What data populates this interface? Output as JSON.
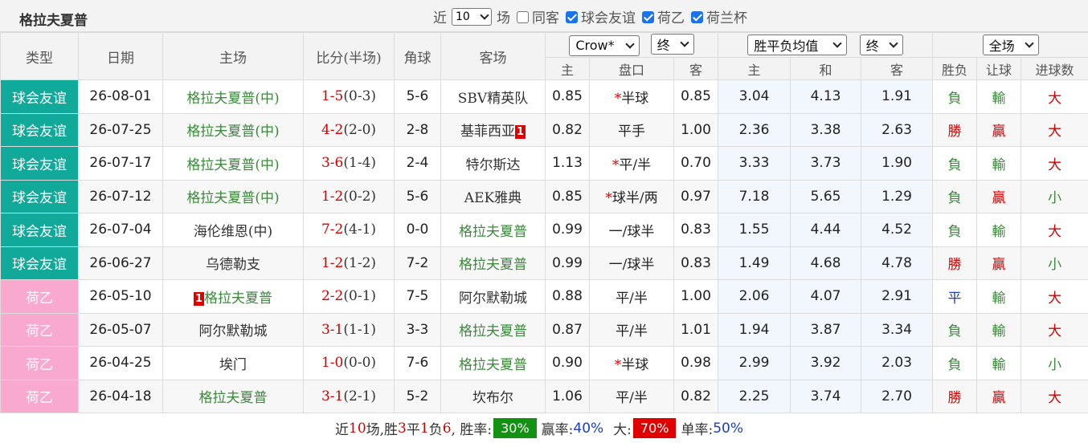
{
  "header": {
    "title": "格拉夫夏普",
    "recent_label": "近",
    "recent_value": "10",
    "unit_label": "场",
    "filters": [
      {
        "label": "同客",
        "checked": false
      },
      {
        "label": "球会友谊",
        "checked": true
      },
      {
        "label": "荷乙",
        "checked": true
      },
      {
        "label": "荷兰杯",
        "checked": true
      }
    ]
  },
  "columns": {
    "type": "类型",
    "date": "日期",
    "home": "主场",
    "score": "比分(半场)",
    "corners": "角球",
    "away": "客场",
    "handicap_company": "Crow*",
    "handicap_stage": "终",
    "euro_type": "胜平负均值",
    "euro_stage": "终",
    "scope": "全场",
    "sub_home": "主",
    "sub_line": "盘口",
    "sub_away": "客",
    "sub_euro_home": "主",
    "sub_euro_draw": "和",
    "sub_euro_away": "客",
    "sub_result": "胜负",
    "sub_handicap_result": "让球",
    "sub_goals": "进球数"
  },
  "matches": [
    {
      "type": "球会友谊",
      "kind": "friendly",
      "date": "26-08-01",
      "home": "格拉夫夏普(中)",
      "home_rank": "",
      "home_focus": true,
      "score": "1-5",
      "half": "(0-3)",
      "corners": "5-6",
      "away": "SBV精英队",
      "away_rank": "",
      "away_focus": false,
      "hcp_home": "0.85",
      "star": "*",
      "line": "半球",
      "hcp_away": "0.85",
      "eu_home": "3.04",
      "eu_draw": "4.13",
      "eu_away": "1.91",
      "result": "負",
      "hcp_result": "輸",
      "goals": "大"
    },
    {
      "type": "球会友谊",
      "kind": "friendly",
      "date": "26-07-25",
      "home": "格拉夫夏普(中)",
      "home_rank": "",
      "home_focus": true,
      "score": "4-2",
      "half": "(2-0)",
      "corners": "2-8",
      "away": "基菲西亚",
      "away_rank": "1",
      "away_focus": false,
      "hcp_home": "0.82",
      "star": "",
      "line": "平手",
      "hcp_away": "1.00",
      "eu_home": "2.36",
      "eu_draw": "3.38",
      "eu_away": "2.63",
      "result": "勝",
      "hcp_result": "贏",
      "goals": "大"
    },
    {
      "type": "球会友谊",
      "kind": "friendly",
      "date": "26-07-17",
      "home": "格拉夫夏普(中)",
      "home_rank": "",
      "home_focus": true,
      "score": "3-6",
      "half": "(1-4)",
      "corners": "2-4",
      "away": "特尔斯达",
      "away_rank": "",
      "away_focus": false,
      "hcp_home": "1.13",
      "star": "*",
      "line": "平/半",
      "hcp_away": "0.70",
      "eu_home": "3.33",
      "eu_draw": "3.73",
      "eu_away": "1.90",
      "result": "負",
      "hcp_result": "輸",
      "goals": "大"
    },
    {
      "type": "球会友谊",
      "kind": "friendly",
      "date": "26-07-12",
      "home": "格拉夫夏普(中)",
      "home_rank": "",
      "home_focus": true,
      "score": "1-2",
      "half": "(0-2)",
      "corners": "5-6",
      "away": "AEK雅典",
      "away_rank": "",
      "away_focus": false,
      "hcp_home": "0.85",
      "star": "*",
      "line": "球半/两",
      "hcp_away": "0.97",
      "eu_home": "7.18",
      "eu_draw": "5.65",
      "eu_away": "1.29",
      "result": "負",
      "hcp_result": "贏",
      "goals": "小"
    },
    {
      "type": "球会友谊",
      "kind": "friendly",
      "date": "26-07-04",
      "home": "海伦维恩(中)",
      "home_rank": "",
      "home_focus": false,
      "score": "7-2",
      "half": "(4-1)",
      "corners": "0-0",
      "away": "格拉夫夏普",
      "away_rank": "",
      "away_focus": true,
      "hcp_home": "0.99",
      "star": "",
      "line": "一/球半",
      "hcp_away": "0.83",
      "eu_home": "1.55",
      "eu_draw": "4.44",
      "eu_away": "4.52",
      "result": "負",
      "hcp_result": "輸",
      "goals": "大"
    },
    {
      "type": "球会友谊",
      "kind": "friendly",
      "date": "26-06-27",
      "home": "乌德勒支",
      "home_rank": "",
      "home_focus": false,
      "score": "1-2",
      "half": "(1-2)",
      "corners": "7-2",
      "away": "格拉夫夏普",
      "away_rank": "",
      "away_focus": true,
      "hcp_home": "0.99",
      "star": "",
      "line": "一/球半",
      "hcp_away": "0.83",
      "eu_home": "1.49",
      "eu_draw": "4.68",
      "eu_away": "4.78",
      "result": "勝",
      "hcp_result": "贏",
      "goals": "小"
    },
    {
      "type": "荷乙",
      "kind": "ere",
      "date": "26-05-10",
      "home": "格拉夫夏普",
      "home_rank": "1",
      "home_focus": true,
      "score": "2-2",
      "half": "(0-1)",
      "corners": "7-5",
      "away": "阿尔默勒城",
      "away_rank": "",
      "away_focus": false,
      "hcp_home": "0.88",
      "star": "",
      "line": "平/半",
      "hcp_away": "1.00",
      "eu_home": "2.06",
      "eu_draw": "4.07",
      "eu_away": "2.91",
      "result": "平",
      "hcp_result": "輸",
      "goals": "大"
    },
    {
      "type": "荷乙",
      "kind": "ere",
      "date": "26-05-07",
      "home": "阿尔默勒城",
      "home_rank": "",
      "home_focus": false,
      "score": "3-1",
      "half": "(1-1)",
      "corners": "3-3",
      "away": "格拉夫夏普",
      "away_rank": "",
      "away_focus": true,
      "hcp_home": "0.87",
      "star": "",
      "line": "平/半",
      "hcp_away": "1.01",
      "eu_home": "1.94",
      "eu_draw": "3.87",
      "eu_away": "3.34",
      "result": "負",
      "hcp_result": "輸",
      "goals": "大"
    },
    {
      "type": "荷乙",
      "kind": "ere",
      "date": "26-04-25",
      "home": "埃门",
      "home_rank": "",
      "home_focus": false,
      "score": "1-0",
      "half": "(0-0)",
      "corners": "7-6",
      "away": "格拉夫夏普",
      "away_rank": "",
      "away_focus": true,
      "hcp_home": "0.90",
      "star": "*",
      "line": "半球",
      "hcp_away": "0.98",
      "eu_home": "2.99",
      "eu_draw": "3.92",
      "eu_away": "2.03",
      "result": "負",
      "hcp_result": "輸",
      "goals": "小"
    },
    {
      "type": "荷乙",
      "kind": "ere",
      "date": "26-04-18",
      "home": "格拉夫夏普",
      "home_rank": "",
      "home_focus": true,
      "score": "3-1",
      "half": "(2-1)",
      "corners": "5-2",
      "away": "坎布尔",
      "away_rank": "",
      "away_focus": false,
      "hcp_home": "1.06",
      "star": "",
      "line": "平/半",
      "hcp_away": "0.82",
      "eu_home": "2.25",
      "eu_draw": "3.74",
      "eu_away": "2.70",
      "result": "勝",
      "hcp_result": "贏",
      "goals": "大"
    }
  ],
  "summary": {
    "t1": "近",
    "n_games": "10",
    "t2": "场,胜",
    "wins": "3",
    "t3": "平",
    "draws": "1",
    "t4": "负",
    "losses": "6",
    "t5": ", 胜率:",
    "win_rate": "30%",
    "t6": "赢率:",
    "cover_rate": "40%",
    "t7": "大:",
    "over_rate": "70%",
    "t8": "单率:",
    "odd_rate": "50%"
  },
  "colors": {
    "friendly": "#11a99a",
    "ere": "#f9a8cf",
    "win": "#d40000",
    "lose": "#3a8a3a",
    "draw": "#1a3cc8"
  }
}
